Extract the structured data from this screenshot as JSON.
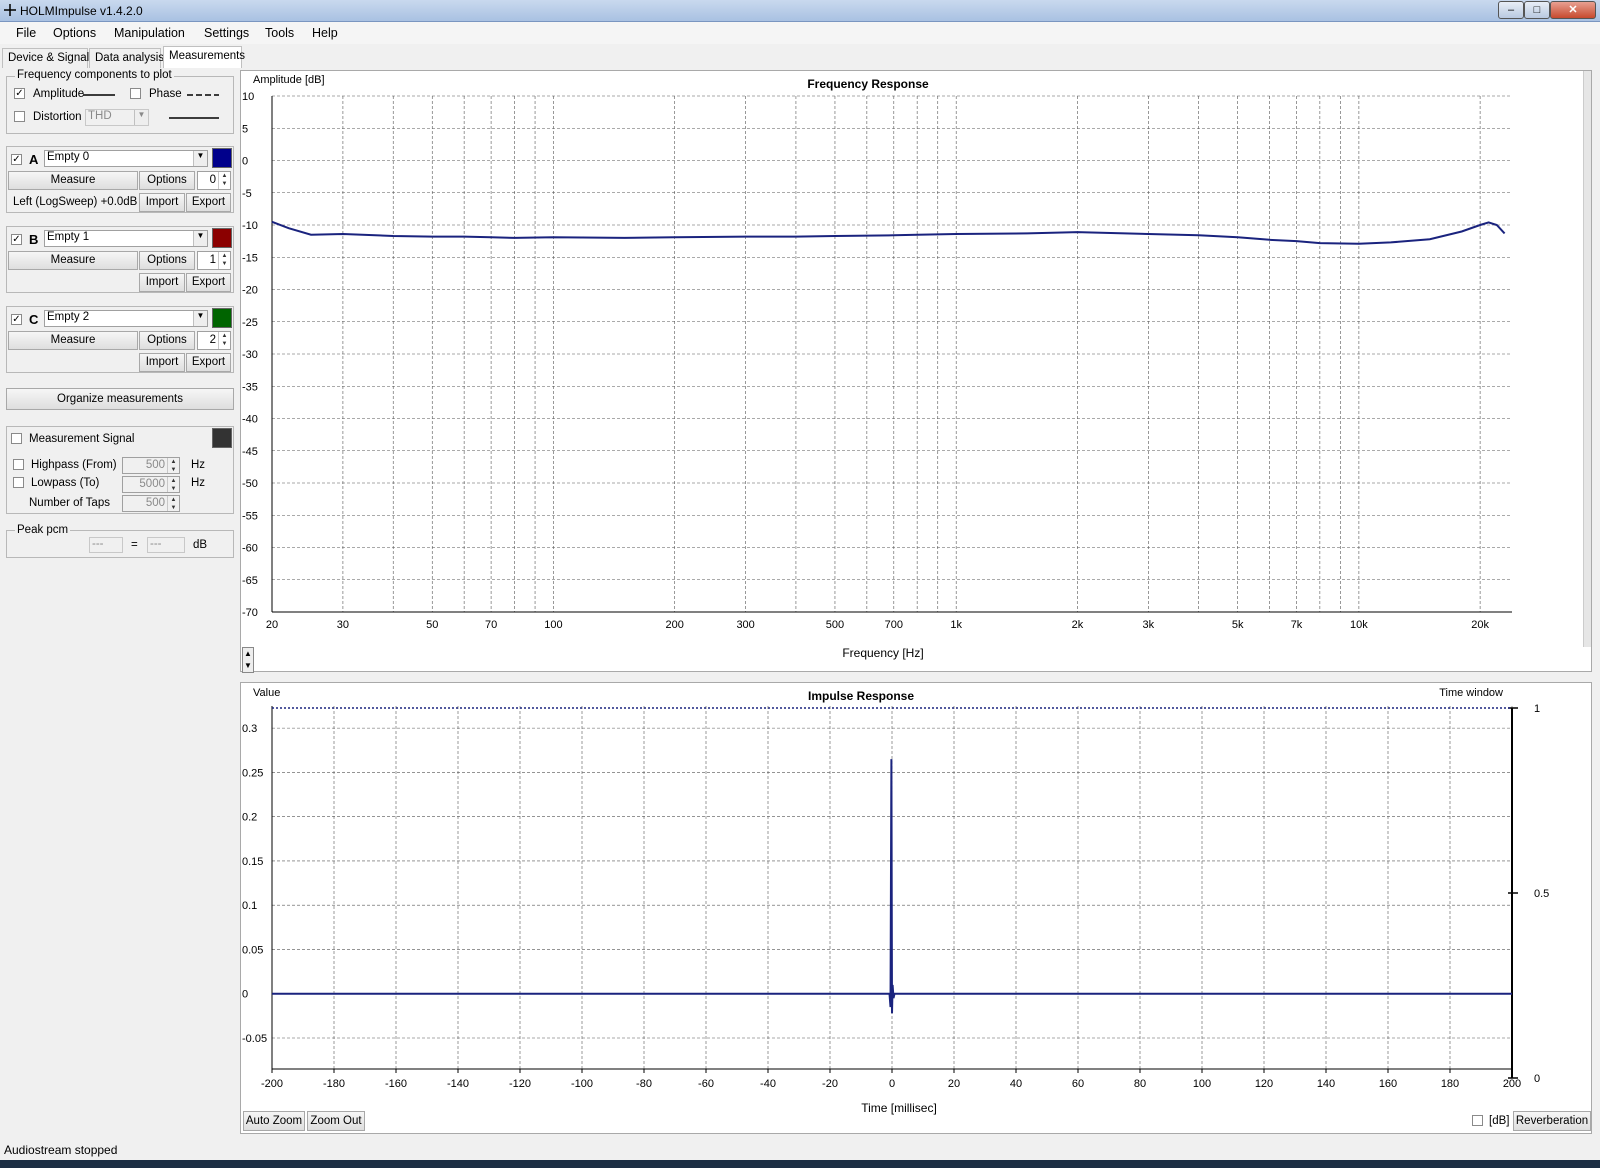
{
  "window": {
    "title": "HOLMImpulse  v1.4.2.0"
  },
  "menu": [
    "File",
    "Options",
    "Manipulation",
    "Settings",
    "Tools",
    "Help"
  ],
  "tabs": [
    "Device & Signal",
    "Data analysis",
    "Measurements"
  ],
  "freq_components": {
    "group_label": "Frequency components to plot",
    "amplitude_label": "Amplitude",
    "amplitude_checked": true,
    "phase_label": "Phase",
    "phase_checked": false,
    "distortion_label": "Distortion",
    "distortion_checked": false,
    "distortion_select": "THD"
  },
  "measurements": [
    {
      "letter": "A",
      "checked": true,
      "name": "Empty 0",
      "color": "#00008b",
      "measure_label": "Measure",
      "options_label": "Options",
      "index": "0",
      "info": "Left (LogSweep) +0.0dB",
      "import_label": "Import",
      "export_label": "Export"
    },
    {
      "letter": "B",
      "checked": true,
      "name": "Empty 1",
      "color": "#8b0000",
      "measure_label": "Measure",
      "options_label": "Options",
      "index": "1",
      "info": "",
      "import_label": "Import",
      "export_label": "Export"
    },
    {
      "letter": "C",
      "checked": true,
      "name": "Empty 2",
      "color": "#006400",
      "measure_label": "Measure",
      "options_label": "Options",
      "index": "2",
      "info": "",
      "import_label": "Import",
      "export_label": "Export"
    }
  ],
  "organize_label": "Organize measurements",
  "signal": {
    "label": "Measurement Signal",
    "checked": false,
    "swatch_color": "#333333",
    "highpass_label": "Highpass (From)",
    "highpass_value": "500",
    "lowpass_label": "Lowpass (To)",
    "lowpass_value": "5000",
    "taps_label": "Number of Taps",
    "taps_value": "500",
    "hz": "Hz"
  },
  "peak": {
    "label": "Peak pcm",
    "value1": "---",
    "eq": "=",
    "value2": "---",
    "unit": "dB"
  },
  "status": "Audiostream stopped",
  "chart_data": [
    {
      "type": "line",
      "title": "Frequency Response",
      "xlabel": "Frequency [Hz]",
      "ylabel": "Amplitude [dB]",
      "xscale": "log",
      "xlim": [
        20,
        24000
      ],
      "ylim": [
        -70,
        10
      ],
      "grid": true,
      "x_ticks": [
        20,
        30,
        50,
        70,
        100,
        200,
        300,
        500,
        700,
        1000,
        2000,
        3000,
        5000,
        7000,
        10000,
        20000
      ],
      "x_tick_labels": [
        "20",
        "30",
        "50",
        "70",
        "100",
        "200",
        "300",
        "500",
        "700",
        "1k",
        "2k",
        "3k",
        "5k",
        "7k",
        "10k",
        "20k"
      ],
      "y_ticks": [
        10,
        5,
        0,
        -5,
        -10,
        -15,
        -20,
        -25,
        -30,
        -35,
        -40,
        -45,
        -50,
        -55,
        -60,
        -65,
        -70
      ],
      "y_tick_labels": [
        "10",
        "5",
        "0",
        "-5",
        "-10",
        "-15",
        "-20",
        "-25",
        "-30",
        "-35",
        "-40",
        "-45",
        "-50",
        "-55",
        "-60",
        "-65",
        "-70"
      ],
      "series": [
        {
          "color": "#1a237e",
          "x": [
            20,
            22,
            25,
            30,
            40,
            50,
            60,
            70,
            80,
            100,
            150,
            200,
            300,
            400,
            500,
            700,
            800,
            1000,
            1500,
            2000,
            3000,
            4000,
            5000,
            6000,
            7000,
            8000,
            10000,
            12000,
            15000,
            18000,
            20000,
            21000,
            22000,
            23000
          ],
          "y": [
            -9.5,
            -10.5,
            -11.5,
            -11.4,
            -11.7,
            -11.8,
            -11.8,
            -11.9,
            -12.0,
            -11.9,
            -12.0,
            -11.9,
            -11.8,
            -11.8,
            -11.7,
            -11.6,
            -11.5,
            -11.4,
            -11.3,
            -11.1,
            -11.4,
            -11.6,
            -11.9,
            -12.3,
            -12.5,
            -12.8,
            -12.9,
            -12.7,
            -12.2,
            -11.0,
            -10.0,
            -9.6,
            -10.0,
            -11.3
          ]
        }
      ]
    },
    {
      "type": "line",
      "title": "Impulse Response",
      "xlabel": "Time [millisec]",
      "ylabel": "Value",
      "y2label": "Time window",
      "xlim": [
        -200,
        200
      ],
      "ylim": [
        -0.085,
        0.325
      ],
      "y2lim": [
        0,
        1
      ],
      "grid": true,
      "x_ticks": [
        -200,
        -180,
        -160,
        -140,
        -120,
        -100,
        -80,
        -60,
        -40,
        -20,
        0,
        20,
        40,
        60,
        80,
        100,
        120,
        140,
        160,
        180,
        200
      ],
      "y_ticks": [
        0.3,
        0.25,
        0.2,
        0.15,
        0.1,
        0.05,
        0,
        -0.05
      ],
      "y_tick_labels": [
        "0.3",
        "0.25",
        "0.2",
        "0.15",
        "0.1",
        "0.05",
        "0",
        "-0.05"
      ],
      "y2_ticks": [
        1,
        0.5,
        0
      ],
      "y2_tick_labels": [
        "1",
        "0.5",
        "0"
      ],
      "series": [
        {
          "color": "#1a237e",
          "x": [
            -200,
            -0.8,
            -0.5,
            -0.2,
            0,
            0.2,
            0.5,
            0.8,
            200
          ],
          "y": [
            0,
            0,
            -0.015,
            0.265,
            -0.022,
            0.01,
            -0.005,
            0,
            0
          ]
        },
        {
          "color": "#1a237e",
          "axis": "y2",
          "x": [
            -200,
            -0.01,
            0.01,
            200
          ],
          "y": [
            1,
            1,
            1,
            1
          ]
        }
      ]
    }
  ],
  "bottom_controls": {
    "auto_zoom": "Auto Zoom",
    "zoom_out": "Zoom Out",
    "db_label": "[dB]",
    "reverberation": "Reverberation"
  }
}
